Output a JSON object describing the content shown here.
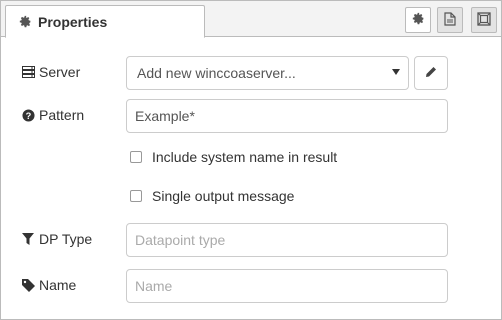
{
  "tabs": {
    "properties_label": "Properties",
    "icons": [
      "gear-icon",
      "file-icon",
      "frame-icon"
    ]
  },
  "form": {
    "server": {
      "label": "Server",
      "value": "Add new winccoaserver...",
      "icon": "server-icon"
    },
    "pattern": {
      "label": "Pattern",
      "value": "Example*",
      "icon": "question-circle-icon"
    },
    "include_system_name": {
      "label": "Include system name in result",
      "checked": false
    },
    "single_output": {
      "label": "Single output message",
      "checked": false
    },
    "dp_type": {
      "label": "DP Type",
      "value": "",
      "placeholder": "Datapoint type",
      "icon": "filter-icon"
    },
    "name": {
      "label": "Name",
      "value": "",
      "placeholder": "Name",
      "icon": "tag-icon"
    }
  },
  "colors": {
    "border": "#cccccc",
    "tab_bar": "#f3f3f3",
    "text": "#333333",
    "placeholder": "#aaaaaa"
  }
}
